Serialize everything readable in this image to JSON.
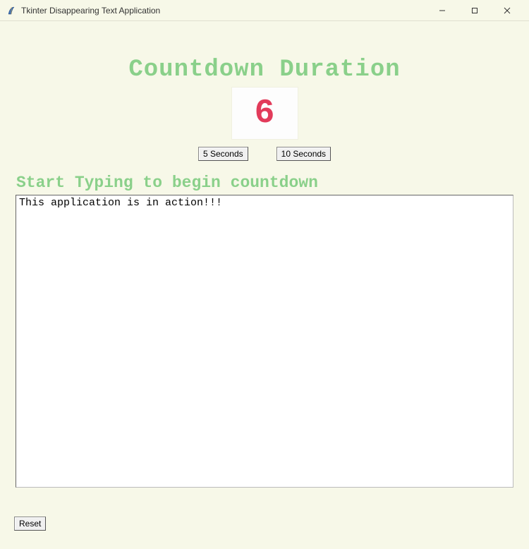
{
  "window": {
    "title": "Tkinter Disappearing Text Application"
  },
  "heading": "Countdown Duration",
  "countdown": "6",
  "buttons": {
    "five": "5 Seconds",
    "ten": "10 Seconds",
    "reset": "Reset"
  },
  "subheading": "Start Typing to begin countdown",
  "text_value": "This application is in action!!!",
  "colors": {
    "bg": "#f7f8e8",
    "heading_green": "#8ad08a",
    "countdown_red": "#e23b5a"
  }
}
